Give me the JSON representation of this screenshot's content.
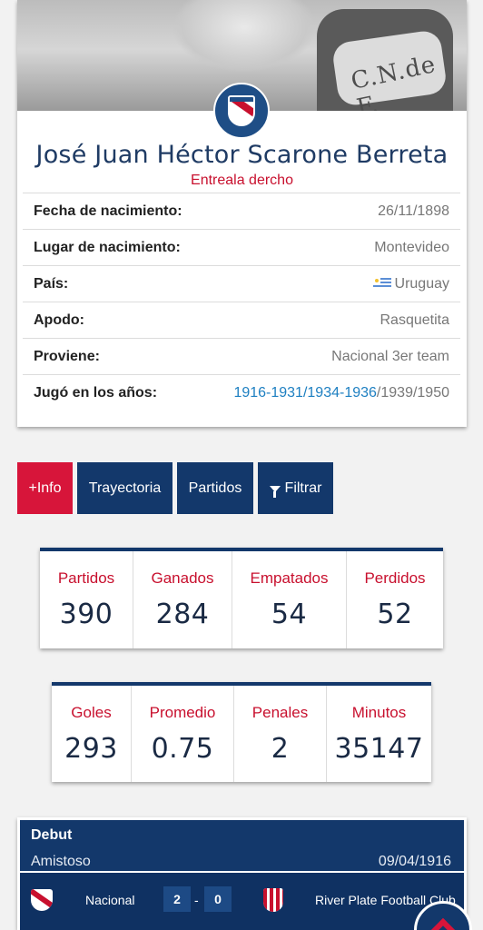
{
  "player": {
    "name": "José Juan Héctor Scarone Berreta",
    "position": "Entreala dercho",
    "crest_text": "C.N.de F."
  },
  "info": [
    {
      "label": "Fecha de nacimiento:",
      "value": "26/11/1898"
    },
    {
      "label": "Lugar de nacimiento:",
      "value": "Montevideo"
    },
    {
      "label": "País:",
      "value": "Uruguay",
      "icon": "uruguay-flag-icon"
    },
    {
      "label": "Apodo:",
      "value": "Rasquetita"
    },
    {
      "label": "Proviene:",
      "value": "Nacional 3er team"
    },
    {
      "label": "Jugó en los años:",
      "years_link": "1916-1931/1934-1936",
      "years_rest": "/1939/1950"
    }
  ],
  "tabs": {
    "info": "+Info",
    "trayectoria": "Trayectoria",
    "partidos": "Partidos",
    "filtrar": "Filtrar"
  },
  "stats_1": [
    {
      "label": "Partidos",
      "value": "390"
    },
    {
      "label": "Ganados",
      "value": "284"
    },
    {
      "label": "Empatados",
      "value": "54"
    },
    {
      "label": "Perdidos",
      "value": "52"
    }
  ],
  "stats_2": [
    {
      "label": "Goles",
      "value": "293"
    },
    {
      "label": "Promedio",
      "value": "0.75"
    },
    {
      "label": "Penales",
      "value": "2"
    },
    {
      "label": "Minutos",
      "value": "35147"
    }
  ],
  "debut": {
    "title": "Debut",
    "type": "Amistoso",
    "date": "09/04/1916",
    "home_team": "Nacional",
    "home_score": "2",
    "separator": "-",
    "away_score": "0",
    "away_team": "River Plate Football Club"
  },
  "colors": {
    "navy": "#13386b",
    "red": "#d7153a",
    "link": "#1d7fc1"
  }
}
